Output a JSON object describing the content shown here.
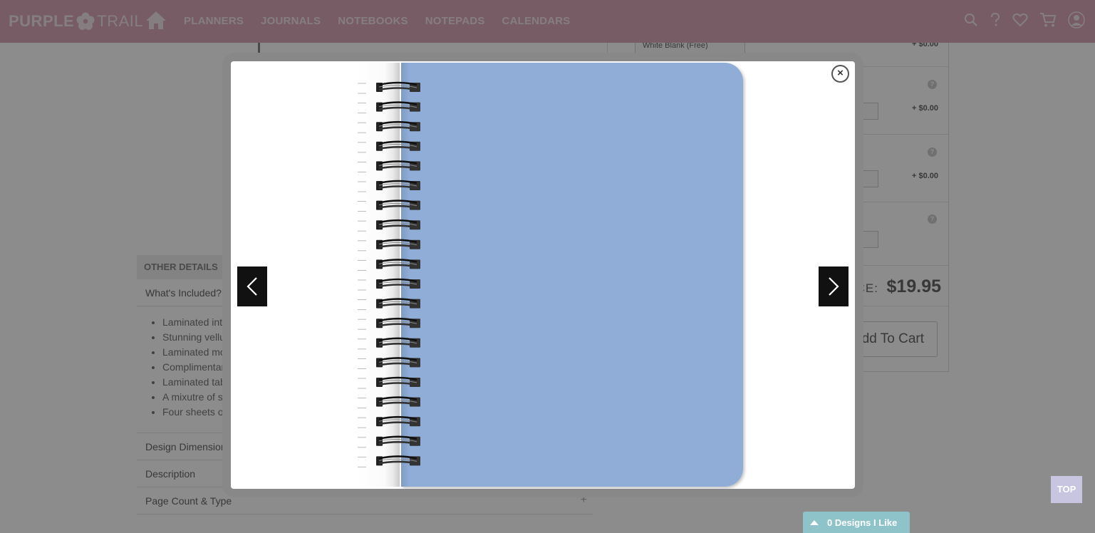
{
  "brand": {
    "logo_word_1": "PURPLE",
    "logo_word_2": "TRAIL"
  },
  "nav": {
    "links": [
      "PLANNERS",
      "JOURNALS",
      "NOTEBOOKS",
      "NOTEPADS",
      "CALENDARS"
    ],
    "icons": [
      "search-icon",
      "help-icon",
      "heart-icon",
      "cart-icon",
      "account-icon"
    ]
  },
  "details": {
    "header": "OTHER DETAILS",
    "whats_included_label": "What's Included?",
    "included_items": [
      "Laminated inte",
      "Stunning vellu",
      "Laminated mo",
      "Complimentar",
      "Laminated tab",
      "A mixutre of s",
      "Four sheets o"
    ],
    "design_dimensions_label": "Design Dimension",
    "description_label": "Description",
    "page_count_label": "Page Count & Type",
    "expand_symbol": "+"
  },
  "options": {
    "first_select_value": "White Blank (Free)",
    "prices": [
      "+ $0.00",
      "+ $0.00",
      "+ $0.00"
    ],
    "help_symbol": "?"
  },
  "pricing": {
    "price_label": "PRICE:",
    "price_value": "$19.95",
    "add_to_cart_label": "Add To Cart"
  },
  "floating": {
    "top_label": "TOP",
    "designs_label": "0 Designs I Like"
  },
  "modal": {
    "close_symbol": "×",
    "cover_color": "#8fadd6",
    "spiral_coils": 20
  },
  "colors": {
    "nav_bg": "#d9a8b8",
    "top_btn": "#c7c5df",
    "designs_tab": "#8ec3c9"
  }
}
